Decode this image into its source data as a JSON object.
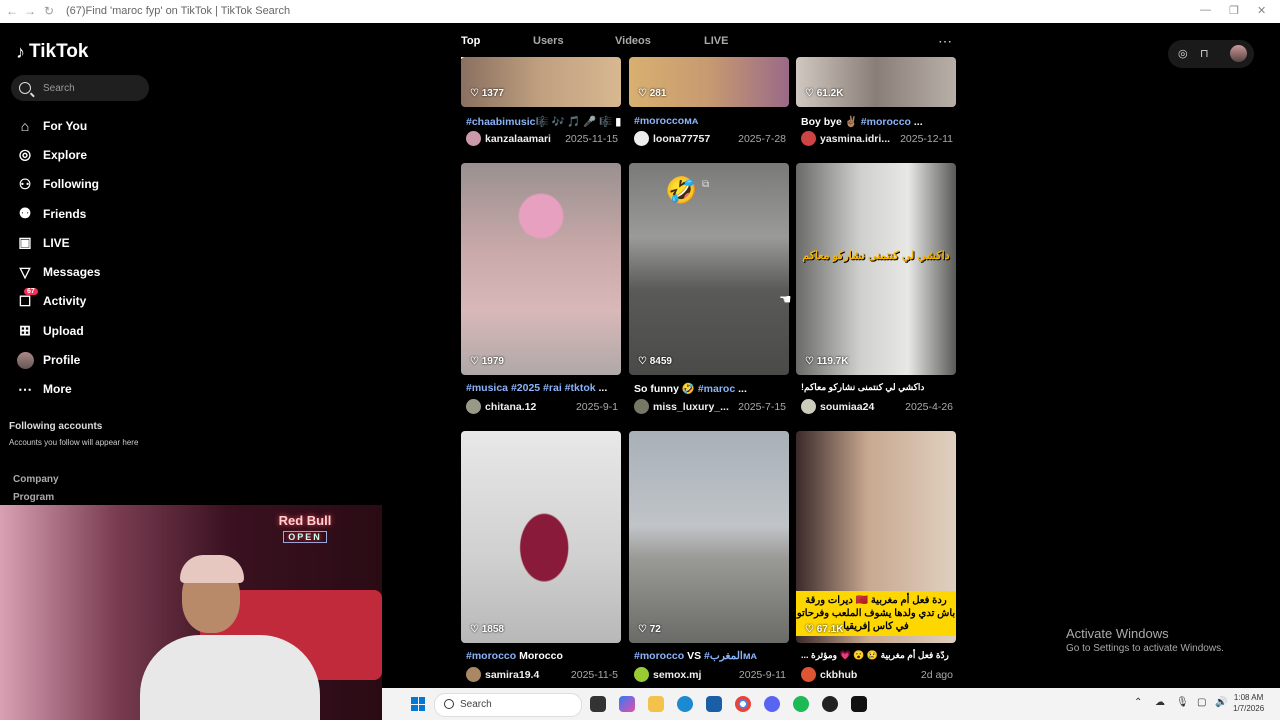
{
  "window": {
    "title": "(67)Find 'maroc fyp' on TikTok | TikTok Search"
  },
  "sidebar": {
    "logo": "TikTok",
    "search_placeholder": "Search",
    "items": [
      {
        "label": "For You",
        "icon": "home-icon"
      },
      {
        "label": "Explore",
        "icon": "compass-icon"
      },
      {
        "label": "Following",
        "icon": "user-follow-icon"
      },
      {
        "label": "Friends",
        "icon": "friends-icon"
      },
      {
        "label": "LIVE",
        "icon": "live-tv-icon"
      },
      {
        "label": "Messages",
        "icon": "messages-icon"
      },
      {
        "label": "Activity",
        "icon": "activity-icon",
        "badge": "67"
      },
      {
        "label": "Upload",
        "icon": "upload-icon"
      },
      {
        "label": "Profile",
        "icon": "avatar"
      },
      {
        "label": "More",
        "icon": "more-icon"
      }
    ],
    "following_heading": "Following accounts",
    "following_sub": "Accounts you follow will appear here",
    "links": [
      "Company",
      "Program"
    ]
  },
  "webcam": {
    "neon_brand": "Red Bull",
    "neon_sub": "OPEN"
  },
  "tabs": [
    {
      "label": "Top",
      "active": true
    },
    {
      "label": "Users",
      "active": false
    },
    {
      "label": "Videos",
      "active": false
    },
    {
      "label": "LIVE",
      "active": false
    }
  ],
  "videos": [
    {
      "likes": "1377",
      "desc_tag": "#chaabimusic",
      "desc_rest": "🎼 🎶 🎵 🎤 🎼 ▮",
      "user": "kanzalaamari",
      "date": "2025-11-15"
    },
    {
      "likes": "281",
      "desc_tag": "#moroccoᴍᴀ",
      "desc_rest": "",
      "user": "loona77757",
      "date": "2025-7-28"
    },
    {
      "likes": "61.2K",
      "desc_pre": "Boy bye ✌🏽 ",
      "desc_tag": "#morocco",
      "desc_rest": " ...",
      "user": "yasmina.idri...",
      "date": "2025-12-11"
    },
    {
      "likes": "1979",
      "desc_tag": "#musica #2025 #rai #tktok",
      "desc_rest": " ...",
      "user": "chitana.12",
      "date": "2025-9-1"
    },
    {
      "likes": "8459",
      "desc_pre": "So funny 🤣 ",
      "desc_tag": "#maroc",
      "desc_rest": " ...",
      "user": "miss_luxury_...",
      "date": "2025-7-15",
      "overlay_emoji": "🤣"
    },
    {
      "likes": "119.7K",
      "desc_pre": "!داكشي لي كنتمنى نشاركو معاكم",
      "desc_tag": "",
      "desc_rest": "",
      "user": "soumiaa24",
      "date": "2025-4-26",
      "overlay_text": "داكشي لي كنتمنى نشاركو معاكم"
    },
    {
      "likes": "1858",
      "desc_tag": "#morocco",
      "desc_rest": " Morocco",
      "user": "samira19.4",
      "date": "2025-11-5"
    },
    {
      "likes": "72",
      "desc_tag": "#morocco",
      "desc_rest": " VS ",
      "desc_tag2": "#المغربᴍᴀ",
      "user": "semox.mj",
      "date": "2025-9-11"
    },
    {
      "likes": "67.1K",
      "desc_pre": "ردّة فعل أم مغربية 😢 😮 💗 ومؤثرة ...",
      "desc_tag": "",
      "desc_rest": "",
      "user": "ckbhub",
      "date": "2d ago",
      "overlay_text": "ردة فعل أم مغربية 🇲🇦 ديرات ورقة باش تدي ولدها يشوف الملعب وفرحاتو في كاس إفريقيا"
    }
  ],
  "watermark": {
    "line1": "Activate Windows",
    "line2": "Go to Settings to activate Windows."
  },
  "taskbar": {
    "search": "Search",
    "time": "1:08 AM",
    "date": "1/7/2026"
  },
  "colors": {
    "accent": "#fe2c55",
    "hashtag": "#8ab4f8",
    "background": "#000000"
  }
}
